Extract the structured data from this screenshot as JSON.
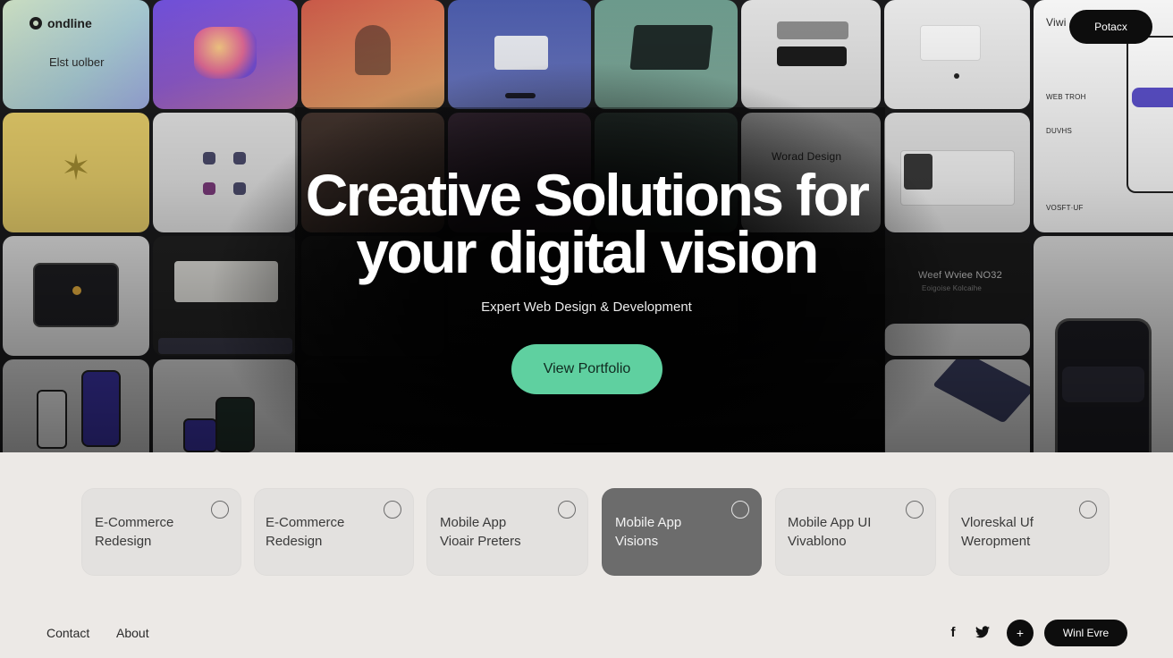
{
  "brand": {
    "name": "ondline",
    "tagline": "Elst uolber"
  },
  "top_pill_label": "Potacx",
  "hero": {
    "title_line1": "Creative Solutions for",
    "title_line2": "your digital vision",
    "subtitle": "Expert Web Design & Development",
    "cta_label": "View Portfolio"
  },
  "tiles": {
    "web_design_label": "Worad Design",
    "right_panel_heading": "Viwi",
    "right_panel_label1": "WEB TROH",
    "right_panel_label2": "DUVHS",
    "right_panel_label3": "VOSFT·UF",
    "dark_tile_caption1": "Weef Wviee NO32",
    "dark_tile_caption2": "Eoigoise Kolcaihe"
  },
  "cards": [
    {
      "line1": "E-Commerce",
      "line2": "Redesign",
      "active": false
    },
    {
      "line1": "E-Commerce",
      "line2": "Redesign",
      "active": false
    },
    {
      "line1": "Mobile App",
      "line2": "Vioair Preters",
      "active": false
    },
    {
      "line1": "Mobile App",
      "line2": "Visions",
      "active": true
    },
    {
      "line1": "Mobile App UI",
      "line2": "Vivablono",
      "active": false
    },
    {
      "line1": "Vloreskal Uf",
      "line2": "Weropment",
      "active": false
    }
  ],
  "footer": {
    "contact": "Contact",
    "about": "About",
    "plus_glyph": "+",
    "pill_label": "Winl Evre",
    "facebook_glyph": "f"
  },
  "colors": {
    "accent": "#5fd0a0",
    "dark": "#0d0d0d",
    "card_bg": "#e3e1df",
    "card_active": "#6c6c6c",
    "page_bg": "#ece9e6"
  }
}
